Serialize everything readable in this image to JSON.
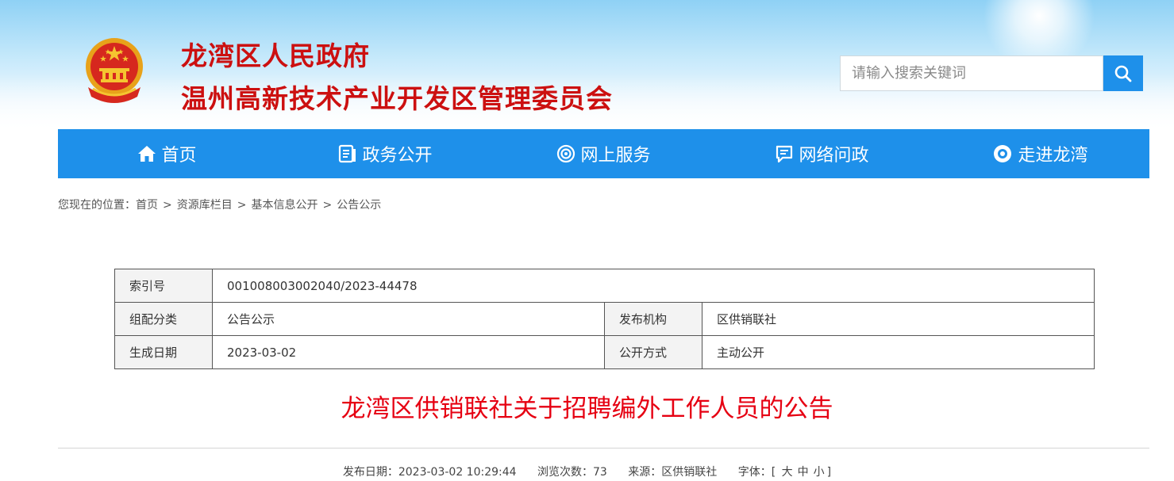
{
  "header": {
    "title_line1": "龙湾区人民政府",
    "title_line2": "温州高新技术产业开发区管理委员会",
    "emblem_icon": "national-emblem-icon",
    "search": {
      "placeholder": "请输入搜索关键词",
      "button_icon": "search-icon"
    }
  },
  "nav": {
    "items": [
      {
        "label": "首页",
        "icon": "home-icon"
      },
      {
        "label": "政务公开",
        "icon": "document-icon"
      },
      {
        "label": "网上服务",
        "icon": "service-icon"
      },
      {
        "label": "网络问政",
        "icon": "message-icon"
      },
      {
        "label": "走进龙湾",
        "icon": "eye-icon"
      }
    ]
  },
  "breadcrumb": {
    "prefix": "您现在的位置：",
    "items": [
      "首页",
      "资源库栏目",
      "基本信息公开",
      "公告公示"
    ],
    "separator": ">"
  },
  "meta_table": {
    "index_label": "索引号",
    "index_value": "001008003002040/2023-44478",
    "category_label": "组配分类",
    "category_value": "公告公示",
    "publisher_label": "发布机构",
    "publisher_value": "区供销联社",
    "date_label": "生成日期",
    "date_value": "2023-03-02",
    "disclosure_label": "公开方式",
    "disclosure_value": "主动公开"
  },
  "article": {
    "title": "龙湾区供销联社关于招聘编外工作人员的公告",
    "publish_date_label": "发布日期：",
    "publish_date": "2023-03-02 10:29:44",
    "views_label": "浏览次数：",
    "views": "73",
    "source_label": "来源：",
    "source": "区供销联社",
    "font_label": "字体：",
    "font_open": "[",
    "font_large": "大",
    "font_medium": "中",
    "font_small": "小",
    "font_close": "]"
  },
  "colors": {
    "nav_blue": "#1e90ea",
    "title_red": "#cc1010",
    "article_title_red": "#e60012"
  }
}
